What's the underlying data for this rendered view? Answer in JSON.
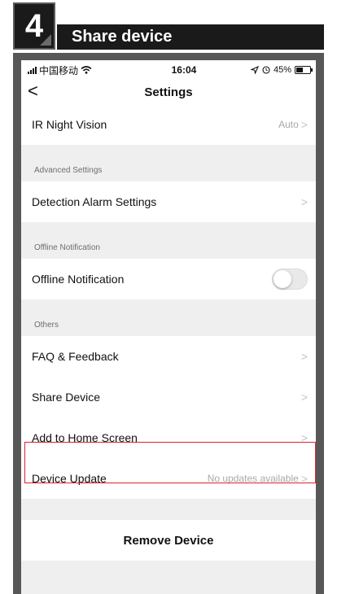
{
  "step": {
    "number": "4",
    "title": "Share device"
  },
  "status_bar": {
    "carrier": "中国移动",
    "time": "16:04",
    "battery": "45%"
  },
  "nav": {
    "title": "Settings"
  },
  "rows": {
    "ir_night_vision": {
      "label": "IR Night Vision",
      "value": "Auto"
    },
    "detection_alarm": {
      "label": "Detection Alarm Settings"
    },
    "offline_notification": {
      "label": "Offline Notification",
      "toggle_on": false
    },
    "faq": {
      "label": "FAQ & Feedback"
    },
    "share_device": {
      "label": "Share Device",
      "highlighted": true
    },
    "add_home": {
      "label": "Add to Home Screen"
    },
    "device_update": {
      "label": "Device Update",
      "value": "No updates available"
    }
  },
  "sections": {
    "advanced": "Advanced Settings",
    "offline": "Offline Notification",
    "others": "Others"
  },
  "remove_button": "Remove Device",
  "chevron": ">",
  "back_glyph": "<",
  "colors": {
    "highlight": "#d9232e",
    "header_bg": "#1a1a1a"
  }
}
